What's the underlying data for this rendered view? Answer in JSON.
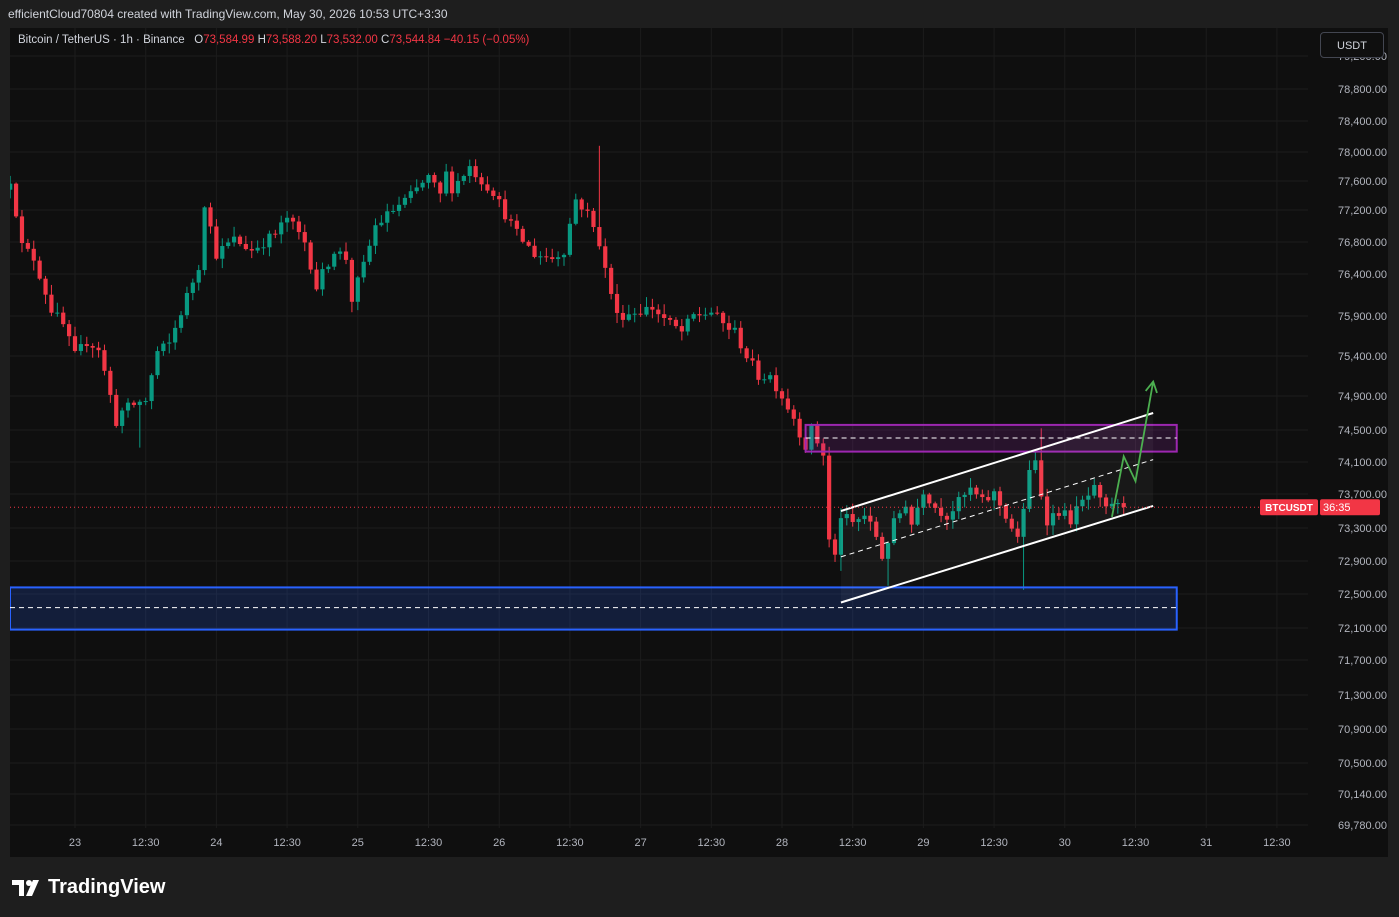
{
  "header": {
    "attribution": "efficientCloud70804 created with TradingView.com, May 30, 2026 10:53 UTC+3:30"
  },
  "legend": {
    "symbol": "Bitcoin / TetherUS · 1h · Binance",
    "o_label": "O",
    "o_value": "73,584.99",
    "h_label": "H",
    "h_value": "73,588.20",
    "l_label": "L",
    "l_value": "73,532.00",
    "c_label": "C",
    "c_value": "73,544.84",
    "change": "−40.15 (−0.05%)"
  },
  "currency_button": "USDT",
  "price_tag": {
    "symbol": "BTCUSDT",
    "countdown": "36:35",
    "price": 73544.84
  },
  "logo": {
    "text": "TradingView",
    "icon": "tradingview-logo-icon"
  },
  "colors": {
    "up": "#089981",
    "down": "#f23645",
    "background": "#0f0f0f",
    "purple_zone": "#9c27b0",
    "blue_zone": "#2962ff",
    "arrow": "#4caf50",
    "channel": "#ffffff"
  },
  "chart_data": {
    "type": "candlestick",
    "symbol": "BTCUSDT",
    "interval": "1h",
    "y_ticks": [
      79200,
      78800,
      78400,
      78000,
      77600,
      77200,
      76800,
      76400,
      75900,
      75400,
      74900,
      74500,
      74100,
      73700,
      73300,
      72900,
      72500,
      72100,
      71700,
      71300,
      70900,
      70500,
      70140,
      69780
    ],
    "y_tick_labels": [
      "79,200.00",
      "78,800.00",
      "78,400.00",
      "78,000.00",
      "77,600.00",
      "77,200.00",
      "76,800.00",
      "76,400.00",
      "75,900.00",
      "75,400.00",
      "74,900.00",
      "74,500.00",
      "74,100.00",
      "73,700.00",
      "73,300.00",
      "72,900.00",
      "72,500.00",
      "72,100.00",
      "71,700.00",
      "71,300.00",
      "70,900.00",
      "70,500.00",
      "70,140.00",
      "69,780.00"
    ],
    "x_ticks": [
      {
        "t": 0,
        "label": "23"
      },
      {
        "t": 12,
        "label": "12:30"
      },
      {
        "t": 24,
        "label": "24"
      },
      {
        "t": 36,
        "label": "12:30"
      },
      {
        "t": 48,
        "label": "25"
      },
      {
        "t": 60,
        "label": "12:30"
      },
      {
        "t": 72,
        "label": "26"
      },
      {
        "t": 84,
        "label": "12:30"
      },
      {
        "t": 96,
        "label": "27"
      },
      {
        "t": 108,
        "label": "12:30"
      },
      {
        "t": 120,
        "label": "28"
      },
      {
        "t": 132,
        "label": "12:30"
      },
      {
        "t": 144,
        "label": "29"
      },
      {
        "t": 156,
        "label": "12:30"
      },
      {
        "t": 168,
        "label": "30"
      },
      {
        "t": 180,
        "label": "12:30"
      },
      {
        "t": 192,
        "label": "31"
      },
      {
        "t": 204,
        "label": "12:30"
      }
    ],
    "key_points": [
      [
        -11,
        77480
      ],
      [
        -10,
        77620
      ],
      [
        -8,
        76750
      ],
      [
        -6,
        76600
      ],
      [
        -3,
        75980
      ],
      [
        -1,
        75780
      ],
      [
        1,
        75400
      ],
      [
        3,
        75580
      ],
      [
        5,
        75500
      ],
      [
        8,
        74600
      ],
      [
        9,
        74720
      ],
      [
        11,
        74800
      ],
      [
        13,
        74850
      ],
      [
        15,
        75450
      ],
      [
        17,
        75550
      ],
      [
        19,
        75950
      ],
      [
        22,
        76500
      ],
      [
        23,
        77300
      ],
      [
        25,
        76650
      ],
      [
        28,
        76830
      ],
      [
        31,
        76700
      ],
      [
        35,
        76900
      ],
      [
        37,
        77100
      ],
      [
        40,
        76800
      ],
      [
        42,
        76250
      ],
      [
        45,
        76700
      ],
      [
        47,
        76600
      ],
      [
        48,
        76100
      ],
      [
        50,
        76500
      ],
      [
        52,
        77000
      ],
      [
        55,
        77200
      ],
      [
        58,
        77400
      ],
      [
        61,
        77650
      ],
      [
        63,
        77400
      ],
      [
        64,
        77700
      ],
      [
        65,
        77500
      ],
      [
        66,
        77600
      ],
      [
        68,
        77800
      ],
      [
        70,
        77600
      ],
      [
        72,
        77450
      ],
      [
        74,
        77150
      ],
      [
        76,
        76900
      ],
      [
        79,
        76650
      ],
      [
        82,
        76600
      ],
      [
        84,
        76700
      ],
      [
        86,
        77350
      ],
      [
        88,
        77150
      ],
      [
        90,
        76800
      ],
      [
        91,
        76450
      ],
      [
        93,
        75900
      ],
      [
        96,
        75950
      ],
      [
        99,
        76000
      ],
      [
        102,
        75800
      ],
      [
        104,
        75700
      ],
      [
        106,
        75900
      ],
      [
        109,
        75950
      ],
      [
        111,
        75800
      ],
      [
        113,
        75700
      ],
      [
        115,
        75400
      ],
      [
        117,
        75150
      ],
      [
        119,
        75150
      ],
      [
        121,
        74900
      ],
      [
        123,
        74650
      ],
      [
        125,
        74300
      ],
      [
        126,
        74500
      ],
      [
        128,
        74200
      ],
      [
        129,
        73150
      ],
      [
        130,
        72950
      ],
      [
        131,
        73450
      ],
      [
        133,
        73350
      ],
      [
        135,
        73450
      ],
      [
        137,
        73200
      ],
      [
        138,
        72950
      ],
      [
        140,
        73350
      ],
      [
        142,
        73600
      ],
      [
        143,
        73350
      ],
      [
        145,
        73750
      ],
      [
        147,
        73550
      ],
      [
        149,
        73450
      ],
      [
        151,
        73600
      ],
      [
        153,
        73750
      ],
      [
        155,
        73600
      ],
      [
        157,
        73700
      ],
      [
        159,
        73450
      ],
      [
        161,
        73150
      ],
      [
        162,
        73550
      ],
      [
        163,
        73950
      ],
      [
        164,
        74100
      ],
      [
        165,
        73700
      ],
      [
        166,
        73400
      ],
      [
        168,
        73500
      ],
      [
        170,
        73400
      ],
      [
        172,
        73600
      ],
      [
        174,
        73750
      ],
      [
        175,
        73600
      ],
      [
        176,
        73500
      ],
      [
        177,
        73600
      ],
      [
        178,
        73545
      ]
    ],
    "current_price": 73544.84,
    "annotations": {
      "resistance_zone": {
        "t_start": 124,
        "t_end": 187,
        "y_top": 74560,
        "y_bottom": 74230,
        "mid": 74400
      },
      "support_zone": {
        "t_start": -20,
        "t_end": 187,
        "y_top": 72580,
        "y_bottom": 72080,
        "mid": 72340
      },
      "channel_upper": {
        "t1": 130,
        "y1": 73500,
        "t2": 183,
        "y2": 74700
      },
      "channel_lower": {
        "t1": 130,
        "y1": 72400,
        "t2": 183,
        "y2": 73560
      },
      "channel_mid": {
        "t1": 130,
        "y1": 72950,
        "t2": 183,
        "y2": 74130
      },
      "projection_arrow": [
        [
          176,
          73430
        ],
        [
          178,
          74170
        ],
        [
          180,
          73860
        ],
        [
          183,
          75080
        ]
      ]
    }
  }
}
